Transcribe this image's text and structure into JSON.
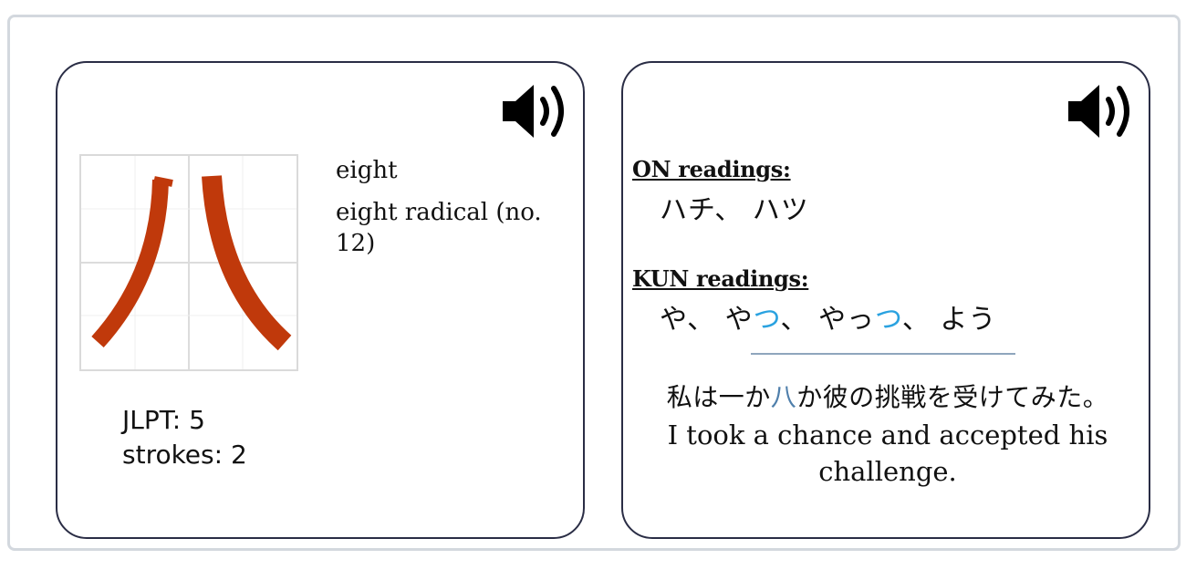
{
  "kanji_card": {
    "character": "八",
    "meanings": [
      "eight",
      "eight radical (no. 12)"
    ],
    "jlpt_label": "JLPT: 5",
    "strokes_label": "strokes: 2",
    "stroke_color": "#c0390b",
    "audio_icon": "speaker-icon"
  },
  "readings_card": {
    "on_title": "ON readings:",
    "on_readings": "ハチ、 ハツ",
    "kun_title": "KUN readings:",
    "kun_readings": [
      {
        "stem": "や",
        "okurigana": "",
        "sep": "、 "
      },
      {
        "stem": "や",
        "okurigana": "つ",
        "sep": "、 "
      },
      {
        "stem": "やっ",
        "okurigana": "つ",
        "sep": "、 "
      },
      {
        "stem": "よう",
        "okurigana": "",
        "sep": ""
      }
    ],
    "okurigana_color": "#2aa2e0",
    "example_jp_before": "私は一か",
    "example_jp_highlight": "八",
    "example_jp_after": "か彼の挑戦を受けてみた。",
    "example_en": "I took a chance and accepted his challenge.",
    "audio_icon": "speaker-icon"
  }
}
